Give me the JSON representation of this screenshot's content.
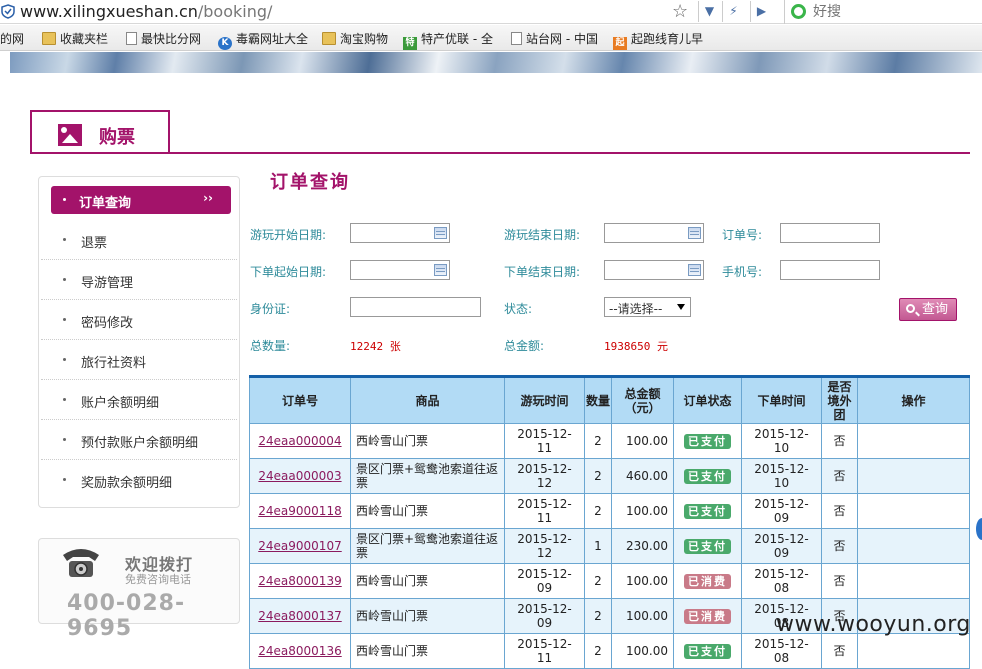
{
  "browser": {
    "url_host": "www.xilingxueshan.cn",
    "url_path": "/booking/",
    "search_placeholder": "好搜",
    "bookmarks": [
      "的网",
      "收藏夹栏",
      "最快比分网",
      "毒霸网址大全",
      "淘宝购物",
      "特产优联 - 全",
      "站台网 - 中国",
      "起跑线育儿早"
    ]
  },
  "tab": {
    "label": "购票"
  },
  "sidebar": {
    "items": [
      {
        "label": "订单查询",
        "active": true,
        "arrow": "››"
      },
      {
        "label": "退票"
      },
      {
        "label": "导游管理"
      },
      {
        "label": "密码修改"
      },
      {
        "label": "旅行社资料"
      },
      {
        "label": "账户余额明细"
      },
      {
        "label": "预付款账户余额明细"
      },
      {
        "label": "奖励款余额明细"
      }
    ]
  },
  "hotline": {
    "title": "欢迎拨打",
    "subtitle": "免费咨询电话",
    "number": "400-028-9695"
  },
  "main": {
    "title": "订单查询",
    "form": {
      "play_start": "游玩开始日期:",
      "play_end": "游玩结束日期:",
      "order_no": "订单号:",
      "order_start": "下单起始日期:",
      "order_end": "下单结束日期:",
      "phone": "手机号:",
      "id_card": "身份证:",
      "status": "状态:",
      "status_value": "--请选择--",
      "query_button": "查询"
    },
    "summary": {
      "count_label": "总数量:",
      "count_value": "12242 张",
      "amount_label": "总金额:",
      "amount_value": "1938650 元"
    },
    "table": {
      "headers": [
        "订单号",
        "商品",
        "游玩时间",
        "数量",
        "总金额（元）",
        "订单状态",
        "下单时间",
        "是否境外团",
        "操作"
      ],
      "rows": [
        {
          "order": "24eaa000004",
          "product": "西岭雪山门票",
          "play_date": "2015-12-11",
          "qty": "2",
          "amount": "100.00",
          "status": "已支付",
          "status_type": "paid",
          "order_date": "2015-12-10",
          "overseas": "否"
        },
        {
          "order": "24eaa000003",
          "product": "景区门票+鸳鸯池索道往返票",
          "play_date": "2015-12-12",
          "qty": "2",
          "amount": "460.00",
          "status": "已支付",
          "status_type": "paid",
          "order_date": "2015-12-10",
          "overseas": "否"
        },
        {
          "order": "24ea9000118",
          "product": "西岭雪山门票",
          "play_date": "2015-12-11",
          "qty": "2",
          "amount": "100.00",
          "status": "已支付",
          "status_type": "paid",
          "order_date": "2015-12-09",
          "overseas": "否"
        },
        {
          "order": "24ea9000107",
          "product": "景区门票+鸳鸯池索道往返票",
          "play_date": "2015-12-12",
          "qty": "1",
          "amount": "230.00",
          "status": "已支付",
          "status_type": "paid",
          "order_date": "2015-12-09",
          "overseas": "否"
        },
        {
          "order": "24ea8000139",
          "product": "西岭雪山门票",
          "play_date": "2015-12-09",
          "qty": "2",
          "amount": "100.00",
          "status": "已消费",
          "status_type": "used",
          "order_date": "2015-12-08",
          "overseas": "否"
        },
        {
          "order": "24ea8000137",
          "product": "西岭雪山门票",
          "play_date": "2015-12-09",
          "qty": "2",
          "amount": "100.00",
          "status": "已消费",
          "status_type": "used",
          "order_date": "2015-12-08",
          "overseas": "否"
        },
        {
          "order": "24ea8000136",
          "product": "西岭雪山门票",
          "play_date": "2015-12-11",
          "qty": "2",
          "amount": "100.00",
          "status": "已支付",
          "status_type": "paid",
          "order_date": "2015-12-08",
          "overseas": "否"
        }
      ]
    }
  },
  "watermark": "www.wooyun.org",
  "colors": {
    "brand": "#a3136a",
    "label": "#2e8b9a",
    "table_header": "#b2dbf5",
    "paid": "#4aa96b",
    "used": "#c97a88"
  }
}
